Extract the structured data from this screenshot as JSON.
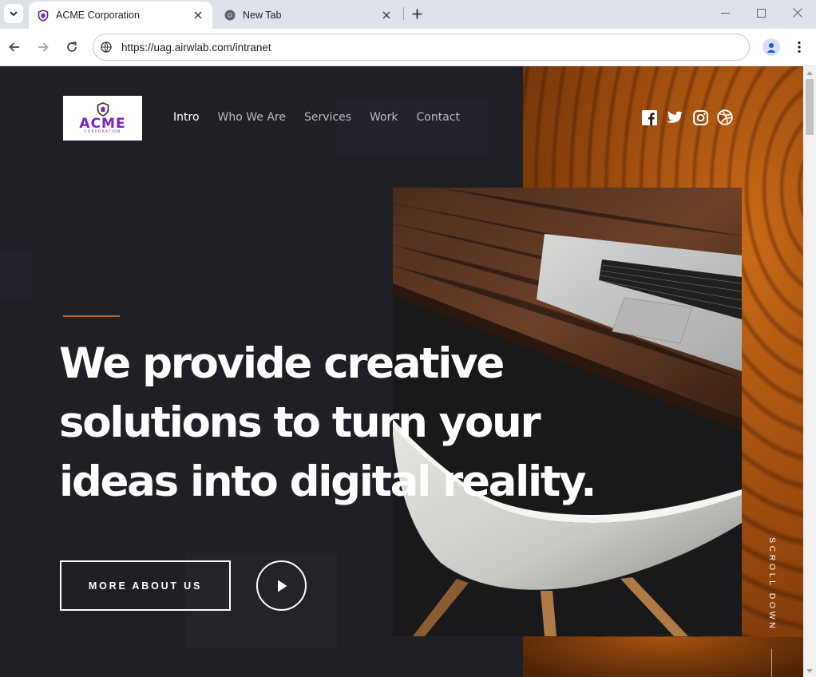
{
  "browser": {
    "tabs": [
      {
        "title": "ACME Corporation",
        "active": true
      },
      {
        "title": "New Tab",
        "active": false
      }
    ],
    "url": "https://uag.airwlab.com/intranet"
  },
  "site": {
    "logo": {
      "brand": "ACME",
      "sub": "CORPORATION"
    },
    "nav": [
      "Intro",
      "Who We Are",
      "Services",
      "Work",
      "Contact"
    ],
    "active_nav": "Intro",
    "social_icons": [
      "facebook-icon",
      "twitter-icon",
      "instagram-icon",
      "dribbble-icon"
    ],
    "hero": {
      "lines": [
        "We provide creative",
        "solutions to turn your",
        "ideas into digital reality."
      ],
      "cta_label": "MORE ABOUT US",
      "scroll_label": "SCROLL DOWN"
    }
  },
  "colors": {
    "page_bg": "#1f1f26",
    "accent": "#c9641b",
    "logo_purple": "#7a22c4"
  }
}
